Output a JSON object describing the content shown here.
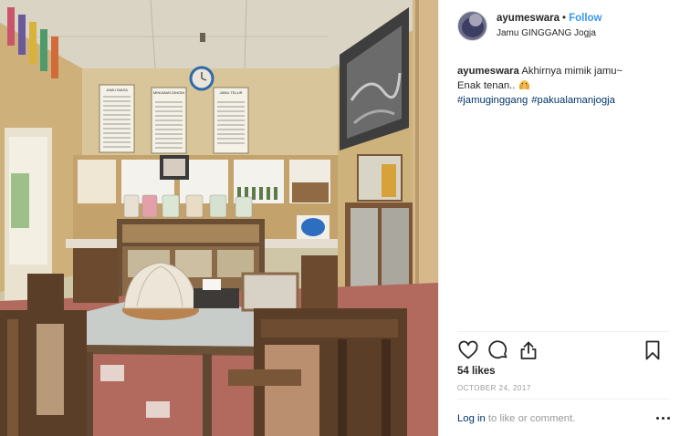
{
  "post": {
    "username": "ayumeswara",
    "separator": "•",
    "follow_label": "Follow",
    "location": "Jamu GINGGANG Jogja"
  },
  "caption": {
    "username": "ayumeswara",
    "line1": "Akhirnya mimik jamu~",
    "line2": "Enak tenan..",
    "emoji": "hands-over-face-emoji",
    "hashtags": [
      "#jamuginggang",
      "#pakualamanjogja"
    ]
  },
  "actions": {
    "icons": [
      "heart-icon",
      "comment-icon",
      "share-icon",
      "bookmark-icon"
    ]
  },
  "likes": "54 likes",
  "date": "OCTOBER 24, 2017",
  "login": {
    "link_label": "Log in",
    "suffix": "to like or comment."
  },
  "more_icon": "more-options-icon",
  "photo": {
    "menu_boards": [
      "JAMU BIASA",
      "MINUMAN DINGIN",
      "JAMU TELUR"
    ]
  }
}
